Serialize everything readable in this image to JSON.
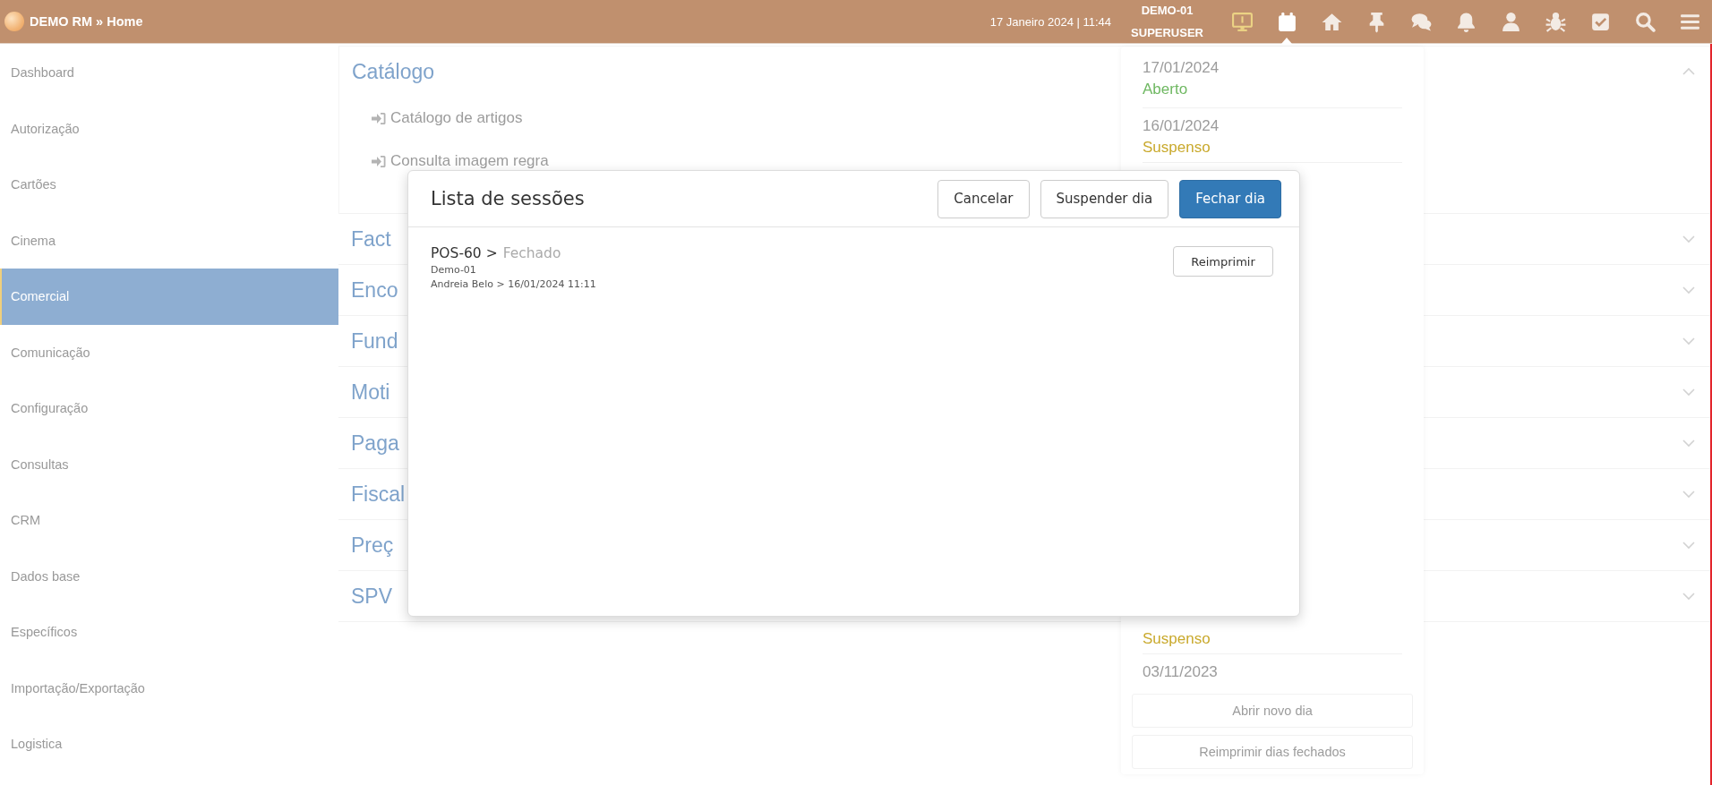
{
  "header": {
    "breadcrumb": "DEMO RM » Home",
    "datetime": "17 Janeiro 2024 | 11:44",
    "terminal": "DEMO-01",
    "user": "SUPERUSER",
    "icons": [
      {
        "kind": "monitor",
        "selected": false
      },
      {
        "kind": "calendar",
        "selected": true
      },
      {
        "kind": "home",
        "selected": false
      },
      {
        "kind": "pin",
        "selected": false
      },
      {
        "kind": "chat",
        "selected": false
      },
      {
        "kind": "bell",
        "selected": false
      },
      {
        "kind": "user",
        "selected": false
      },
      {
        "kind": "bug",
        "selected": false
      },
      {
        "kind": "checkbox",
        "selected": false
      },
      {
        "kind": "search",
        "selected": false
      },
      {
        "kind": "menu",
        "selected": false
      }
    ]
  },
  "sidebar": {
    "items": [
      {
        "label": "Dashboard",
        "selected": false
      },
      {
        "label": "Autorização",
        "selected": false
      },
      {
        "label": "Cartões",
        "selected": false
      },
      {
        "label": "Cinema",
        "selected": false
      },
      {
        "label": "Comercial",
        "selected": true
      },
      {
        "label": "Comunicação",
        "selected": false
      },
      {
        "label": "Configuração",
        "selected": false
      },
      {
        "label": "Consultas",
        "selected": false
      },
      {
        "label": "CRM",
        "selected": false
      },
      {
        "label": "Dados base",
        "selected": false
      },
      {
        "label": "Específicos",
        "selected": false
      },
      {
        "label": "Importação/Exportação",
        "selected": false
      },
      {
        "label": "Logistica",
        "selected": false
      }
    ]
  },
  "sections": [
    {
      "title": "Catálogo",
      "expanded": true,
      "links": [
        "Catálogo de artigos",
        "Consulta imagem regra"
      ]
    },
    {
      "title": "Fact",
      "expanded": false
    },
    {
      "title": "Enco",
      "expanded": false
    },
    {
      "title": "Fund",
      "expanded": false
    },
    {
      "title": "Moti",
      "expanded": false
    },
    {
      "title": "Paga",
      "expanded": false
    },
    {
      "title": "Fiscal",
      "expanded": false
    },
    {
      "title": "Preç",
      "expanded": false
    },
    {
      "title": "SPV",
      "expanded": false
    }
  ],
  "days_panel": {
    "days": [
      {
        "date": "17/01/2024",
        "status": "Aberto",
        "color": "#6fb862"
      },
      {
        "date": "16/01/2024",
        "status": "Suspenso",
        "color": "#c9a92c"
      },
      {
        "status": "Suspenso",
        "color": "#c9a92c"
      },
      {
        "date": "03/11/2023"
      }
    ],
    "buttons": [
      "Abrir novo dia",
      "Reimprimir dias fechados"
    ]
  },
  "modal": {
    "title": "Lista de sessões",
    "buttons": [
      {
        "label": "Cancelar",
        "primary": false
      },
      {
        "label": "Suspender dia",
        "primary": false
      },
      {
        "label": "Fechar dia",
        "primary": true
      }
    ],
    "sessions": [
      {
        "pos": "POS-60 >",
        "state": "Fechado",
        "terminal": "Demo-01",
        "details": "Andreia Belo > 16/01/2024 11:11",
        "action": "Reimprimir"
      }
    ]
  }
}
